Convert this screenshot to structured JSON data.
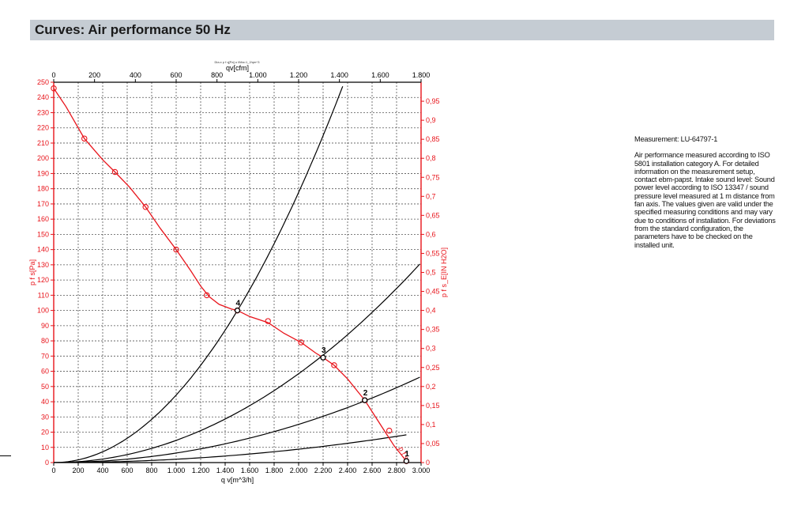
{
  "header": {
    "title": "Curves: Air performance 50 Hz"
  },
  "note": {
    "measurement": "Measurement: LU-64797-1",
    "text": "Air performance measured according to ISO 5801 installation category A. For detailed information on the measurement setup, contact ebm-papst. Intake sound level: Sound power level according to ISO 13347 / sound pressure level measured at 1 m distance from fan axis. The values given are valid under the specified measuring conditions and may vary due to conditions of installation. For deviations from the standard configuration, the parameters have to be checked on the installed unit."
  },
  "colors": {
    "curve": "#e8141b",
    "system": "#000000",
    "grid": "#555555"
  },
  "chart_data": {
    "type": "line",
    "top_note": "Dia.x p f q[Pa] u l/Ma=1_2/qm^3",
    "x_bottom": {
      "label": "q v[m^3/h]",
      "range": [
        0,
        3000
      ],
      "ticks": [
        "0",
        "200",
        "400",
        "600",
        "800",
        "1.000",
        "1.200",
        "1.400",
        "1.600",
        "1.800",
        "2.000",
        "2.200",
        "2.400",
        "2.600",
        "2.800",
        "3.000"
      ]
    },
    "x_top": {
      "label": "qv[cfm]",
      "range": [
        0,
        1800
      ],
      "ticks": [
        "0",
        "200",
        "400",
        "600",
        "800",
        "1.000",
        "1.200",
        "1.400",
        "1.600",
        "1.800"
      ]
    },
    "y_left": {
      "label": "p f s[Pa]",
      "range": [
        0,
        250
      ],
      "ticks": [
        "0",
        "10",
        "20",
        "30",
        "40",
        "50",
        "60",
        "70",
        "80",
        "90",
        "100",
        "110",
        "120",
        "130",
        "140",
        "150",
        "160",
        "170",
        "180",
        "190",
        "200",
        "210",
        "220",
        "230",
        "240",
        "250"
      ]
    },
    "y_right": {
      "label": "p f s_E[IN H2O]",
      "range": [
        0,
        1
      ],
      "ticks": [
        "0",
        "0,05",
        "0,1",
        "0,15",
        "0,2",
        "0,25",
        "0,3",
        "0,35",
        "0,4",
        "0,45",
        "0,5",
        "0,55",
        "0,6",
        "0,65",
        "0,7",
        "0,75",
        "0,8",
        "0,85",
        "0,9",
        "0,95"
      ]
    },
    "grid": true,
    "series": [
      {
        "name": "p f s",
        "role": "fan-curve",
        "points": [
          [
            0,
            246
          ],
          [
            100,
            234
          ],
          [
            250,
            213
          ],
          [
            400,
            199
          ],
          [
            500,
            191
          ],
          [
            620,
            181
          ],
          [
            750,
            168
          ],
          [
            870,
            154
          ],
          [
            1000,
            140
          ],
          [
            1120,
            126
          ],
          [
            1200,
            116
          ],
          [
            1270,
            109
          ],
          [
            1350,
            104
          ],
          [
            1450,
            101
          ],
          [
            1500,
            100
          ],
          [
            1600,
            96
          ],
          [
            1750,
            92
          ],
          [
            1880,
            85
          ],
          [
            2020,
            79
          ],
          [
            2140,
            72
          ],
          [
            2200,
            69
          ],
          [
            2290,
            64
          ],
          [
            2400,
            55
          ],
          [
            2480,
            47
          ],
          [
            2540,
            41
          ],
          [
            2620,
            31
          ],
          [
            2700,
            21
          ],
          [
            2780,
            11
          ],
          [
            2840,
            5
          ],
          [
            2880,
            1
          ]
        ],
        "markers": [
          [
            0,
            246
          ],
          [
            250,
            213
          ],
          [
            500,
            191
          ],
          [
            750,
            168
          ],
          [
            1000,
            140
          ],
          [
            1250,
            110
          ],
          [
            1500,
            100
          ],
          [
            1750,
            93
          ],
          [
            2020,
            79
          ],
          [
            2290,
            64
          ],
          [
            2540,
            41
          ],
          [
            2740,
            21
          ],
          [
            2880,
            1
          ]
        ]
      }
    ],
    "system_curves": [
      {
        "id": "4",
        "k": 4.44e-05,
        "x_max": 2360
      },
      {
        "id": "3",
        "k": 1.46e-05,
        "x_max": 2990
      },
      {
        "id": "2",
        "k": 6.28e-06,
        "x_max": 2990
      },
      {
        "id": "1",
        "k": 2.2e-06,
        "x_max": 2880
      }
    ],
    "operating_points": [
      {
        "id": "4",
        "x": 1500,
        "y": 100
      },
      {
        "id": "3",
        "x": 2200,
        "y": 69
      },
      {
        "id": "2",
        "x": 2540,
        "y": 41
      },
      {
        "id": "1",
        "x": 2880,
        "y": 1
      }
    ]
  }
}
